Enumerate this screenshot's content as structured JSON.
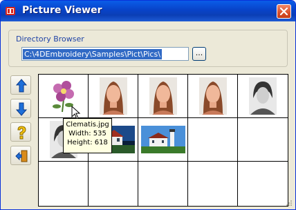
{
  "window": {
    "title": "Picture Viewer"
  },
  "directory_browser": {
    "label": "Directory Browser",
    "path": "C:\\4DEmbroidery\\Samples\\Pict\\Pics\\",
    "browse_label": "..."
  },
  "toolbar": [
    {
      "name": "move-up-button",
      "icon": "up-arrow-icon"
    },
    {
      "name": "move-down-button",
      "icon": "down-arrow-icon"
    },
    {
      "name": "help-button",
      "icon": "question-icon"
    },
    {
      "name": "exit-button",
      "icon": "exit-door-icon"
    }
  ],
  "thumbnails": [
    {
      "icon": "flower-icon"
    },
    {
      "icon": "portrait-woman-icon"
    },
    {
      "icon": "portrait-woman-icon"
    },
    {
      "icon": "portrait-woman-icon"
    },
    {
      "icon": "portrait-vintage-icon"
    },
    {
      "icon": "portrait-vintage-icon"
    },
    {
      "icon": "house-icon"
    },
    {
      "icon": "lighthouse-icon"
    }
  ],
  "tooltip": {
    "filename": "Clematis.jpg",
    "width": "Width: 535",
    "height": "Height: 618"
  },
  "colors": {
    "title_bar": "#0843c8",
    "selection": "#316ac5",
    "tooltip_bg": "#ffffe1"
  }
}
